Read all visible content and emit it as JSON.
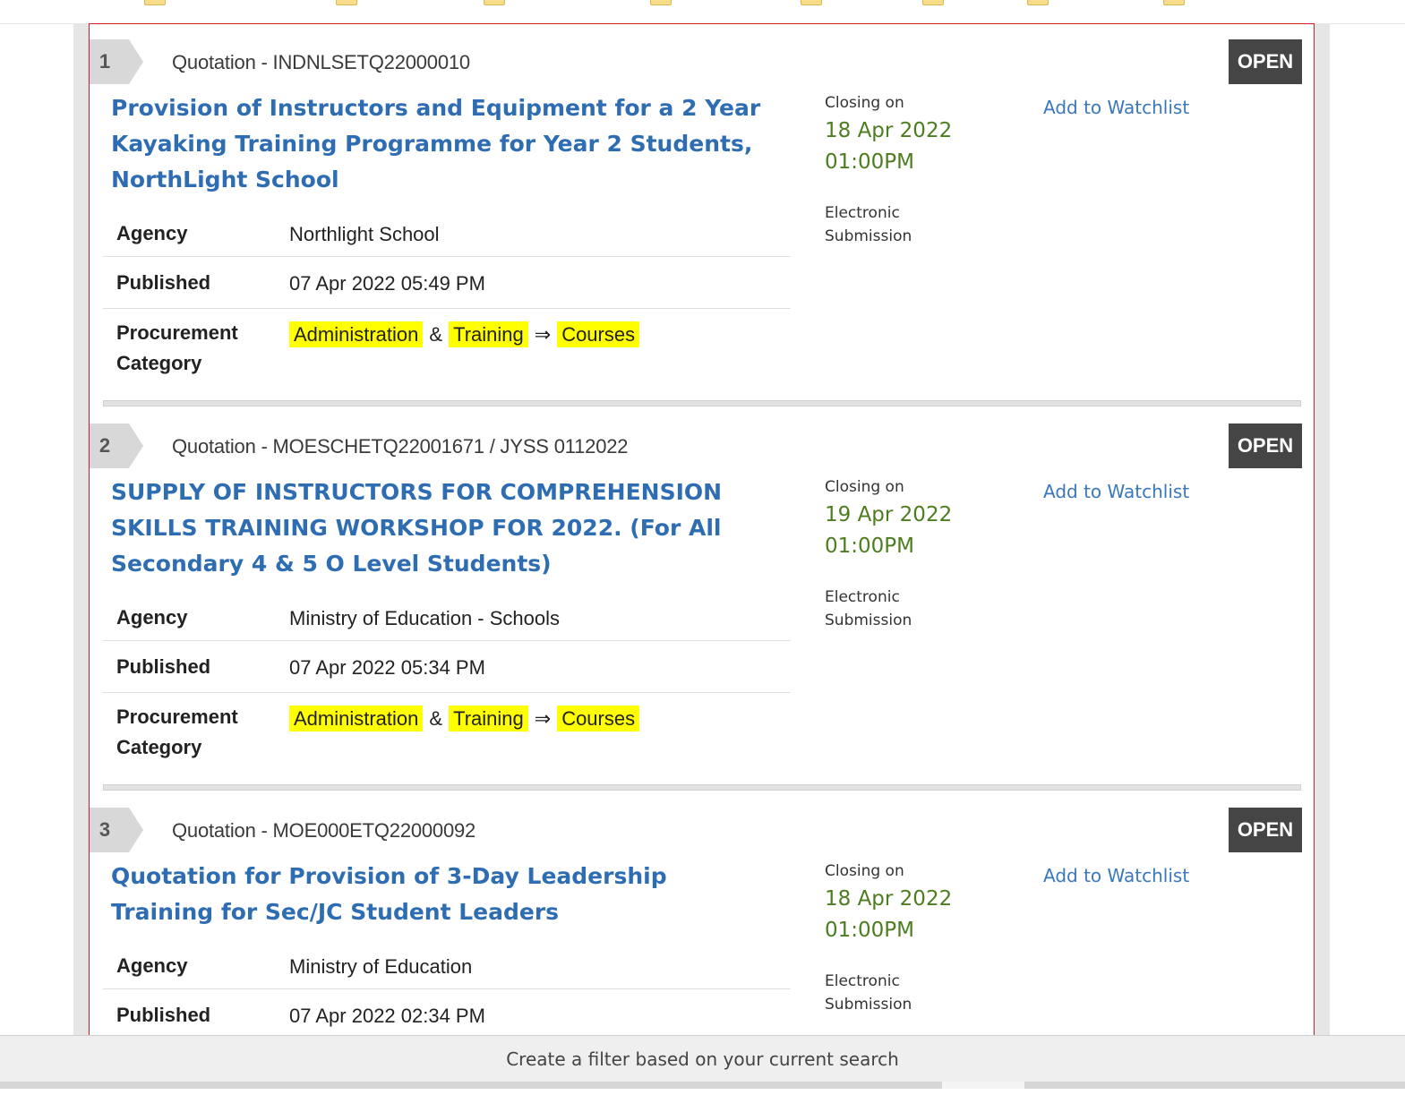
{
  "filter_bar": {
    "label": "Create a filter based on your current search"
  },
  "labels": {
    "closing": "Closing on",
    "submission": "Electronic Submission",
    "watchlist": "Add to Watchlist",
    "agency": "Agency",
    "published": "Published",
    "category_line1": "Procurement",
    "category_line2": "Category",
    "amp": "&",
    "arrow": "⇒"
  },
  "items": [
    {
      "index": "1",
      "ref": "Quotation - INDNLSETQ22000010",
      "status": "OPEN",
      "title": "Provision of Instructors and Equipment for a 2 Year Kayaking Training Programme for Year 2 Students, NorthLight School",
      "closing_date": "18 Apr 2022",
      "closing_time": "01:00PM",
      "agency": "Northlight School",
      "published": "07 Apr 2022 05:49 PM",
      "category": [
        "Administration",
        "Training",
        "Courses"
      ]
    },
    {
      "index": "2",
      "ref": "Quotation - MOESCHETQ22001671 / JYSS 0112022",
      "status": "OPEN",
      "title": "SUPPLY OF INSTRUCTORS FOR COMPREHENSION SKILLS TRAINING WORKSHOP FOR 2022. (For All Secondary 4 & 5 O Level Students)",
      "closing_date": "19 Apr 2022",
      "closing_time": "01:00PM",
      "agency": "Ministry of Education - Schools",
      "published": "07 Apr 2022 05:34 PM",
      "category": [
        "Administration",
        "Training",
        "Courses"
      ]
    },
    {
      "index": "3",
      "ref": "Quotation - MOE000ETQ22000092",
      "status": "OPEN",
      "title": "Quotation for Provision of 3-Day Leadership Training for Sec/JC Student Leaders",
      "closing_date": "18 Apr 2022",
      "closing_time": "01:00PM",
      "agency": "Ministry of Education",
      "published": "07 Apr 2022 02:34 PM"
    }
  ]
}
